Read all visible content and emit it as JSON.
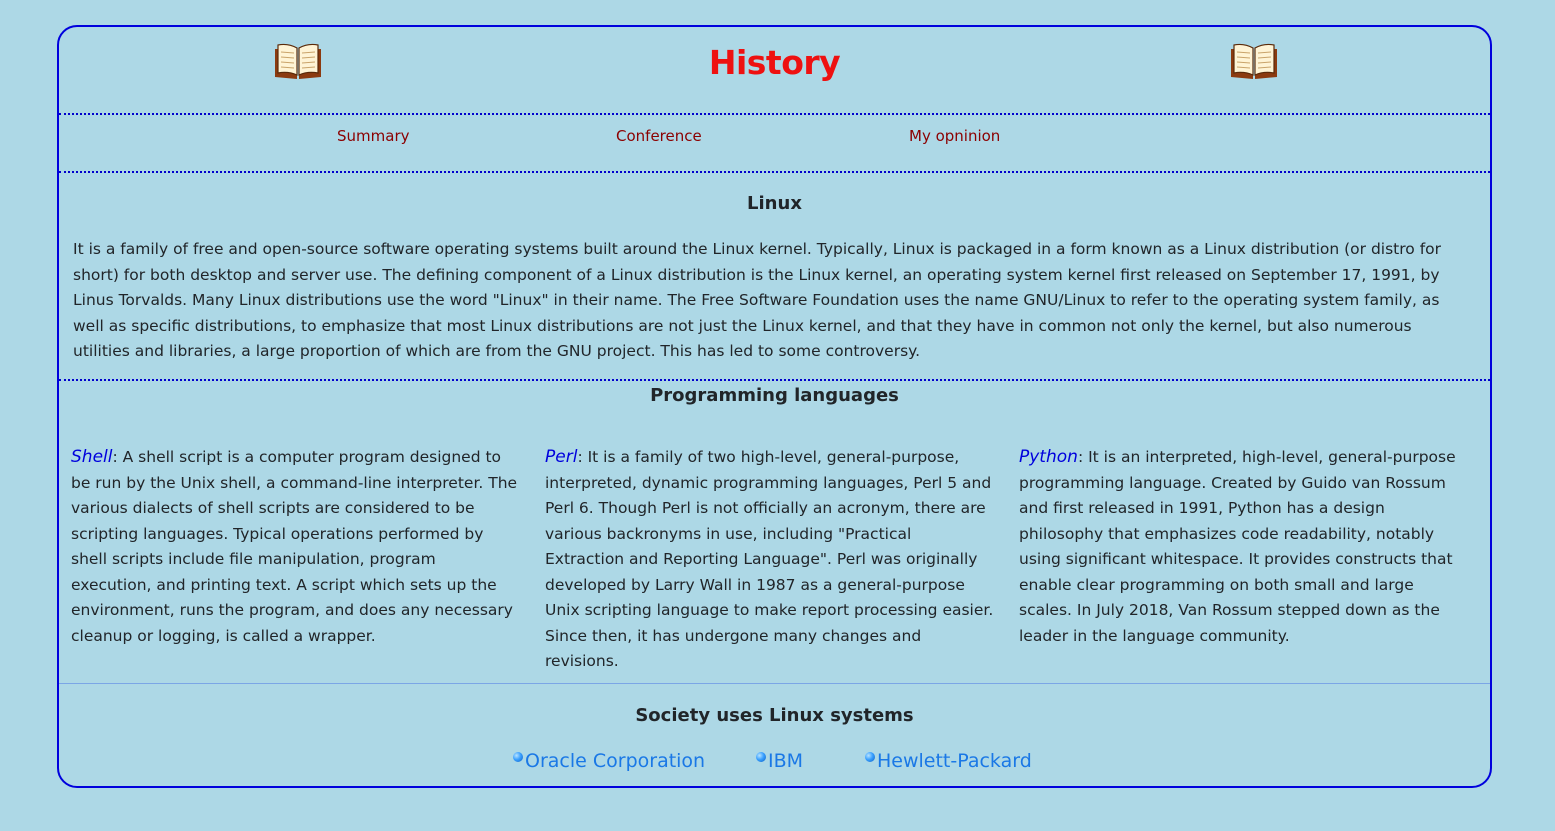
{
  "header": {
    "title": "History"
  },
  "nav": {
    "items": [
      "Summary",
      "Conference",
      "My opninion"
    ]
  },
  "linux": {
    "title": "Linux",
    "text": "It is a family of free and open-source software operating systems built around the Linux kernel. Typically, Linux is packaged in a form known as a Linux distribution (or distro for short) for both desktop and server use. The defining component of a Linux distribution is the Linux kernel, an operating system kernel first released on September 17, 1991, by Linus Torvalds. Many Linux distributions use the word \"Linux\" in their name. The Free Software Foundation uses the name GNU/Linux to refer to the operating system family, as well as specific distributions, to emphasize that most Linux distributions are not just the Linux kernel, and that they have in common not only the kernel, but also numerous utilities and libraries, a large proportion of which are from the GNU project. This has led to some controversy."
  },
  "languages": {
    "title": "Programming languages",
    "items": [
      {
        "name": "Shell",
        "text": ": A shell script is a computer program designed to be run by the Unix shell, a command-line interpreter. The various dialects of shell scripts are considered to be scripting languages. Typical operations performed by shell scripts include file manipulation, program execution, and printing text. A script which sets up the environment, runs the program, and does any necessary cleanup or logging, is called a wrapper."
      },
      {
        "name": "Perl",
        "text": ": It is a family of two high-level, general-purpose, interpreted, dynamic programming languages, Perl 5 and Perl 6. Though Perl is not officially an acronym, there are various backronyms in use, including \"Practical Extraction and Reporting Language\". Perl was originally developed by Larry Wall in 1987 as a general-purpose Unix scripting language to make report processing easier. Since then, it has undergone many changes and revisions."
      },
      {
        "name": "Python",
        "text": ": It is an interpreted, high-level, general-purpose programming language. Created by Guido van Rossum and first released in 1991, Python has a design philosophy that emphasizes code readability, notably using significant whitespace. It provides constructs that enable clear programming on both small and large scales. In July 2018, Van Rossum stepped down as the leader in the language community."
      }
    ]
  },
  "society": {
    "title": "Society uses Linux systems",
    "companies": [
      "Oracle Corporation",
      "IBM",
      "Hewlett-Packard"
    ]
  },
  "icons": {
    "header_left": "open-book-icon",
    "header_right": "open-book-icon",
    "company_bullet": "blue-globe-bullet-icon"
  },
  "colors": {
    "background": "#add8e6",
    "frame_border": "#0000dd",
    "title": "#ee1111",
    "nav_link": "#8b0000",
    "language_name": "#0000dd",
    "company_link": "#1a78e6"
  }
}
